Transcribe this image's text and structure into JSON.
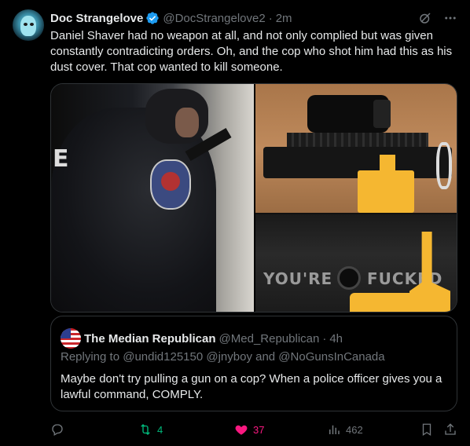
{
  "tweet": {
    "author_name": "Doc Strangelove",
    "author_handle": "@DocStrangelove2",
    "separator": "·",
    "time": "2m",
    "text": "Daniel Shaver had no weapon at all, and not only complied but was given constantly contradicting orders. Oh, and the cop who shot him had this as his dust cover. That cop wanted to kill someone.",
    "media": {
      "engraving_left": "YOU'RE",
      "engraving_right": "FUCKED"
    }
  },
  "quote": {
    "author_name": "The Median Republican",
    "author_handle": "@Med_Republican",
    "separator": "·",
    "time": "4h",
    "replying_to": "Replying to @undid125150 @jnyboy and @NoGunsInCanada",
    "text": "Maybe don't try pulling a gun on a cop? When a police officer gives you a lawful command, COMPLY."
  },
  "actions": {
    "retweets": "4",
    "likes": "37",
    "views": "462"
  },
  "colors": {
    "background": "#000000",
    "text": "#e7e9ea",
    "muted": "#71767b",
    "verified": "#1d9bf0",
    "retweet_active": "#00ba7c",
    "like_active": "#f91880"
  },
  "icons": [
    "verified-badge-icon",
    "grok-icon",
    "more-icon",
    "reply-icon",
    "retweet-icon",
    "heart-icon",
    "views-icon",
    "bookmark-icon",
    "share-icon",
    "us-flag-icon"
  ]
}
